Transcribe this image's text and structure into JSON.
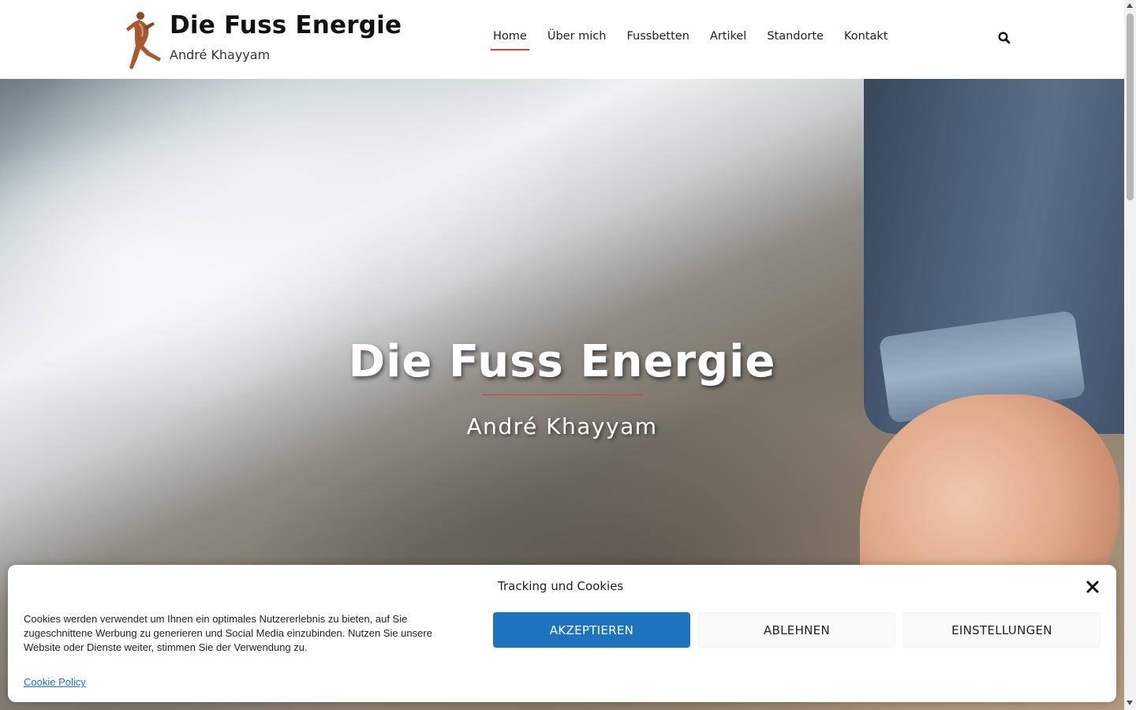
{
  "header": {
    "site_title": "Die Fuss Energie",
    "site_tagline": "André Khayyam",
    "nav": [
      {
        "label": "Home",
        "active": true
      },
      {
        "label": "Über mich",
        "active": false
      },
      {
        "label": "Fussbetten",
        "active": false
      },
      {
        "label": "Artikel",
        "active": false
      },
      {
        "label": "Standorte",
        "active": false
      },
      {
        "label": "Kontakt",
        "active": false
      }
    ],
    "search_icon": "search-icon",
    "logo_icon": "running-figure-logo"
  },
  "hero": {
    "title": "Die Fuss Energie",
    "subtitle": "André Khayyam"
  },
  "cookie_banner": {
    "title": "Tracking und Cookies",
    "text": "Cookies werden verwendet um Ihnen ein optimales Nutzererlebnis zu bieten, auf Sie zugeschnittene Werbung zu generieren und Social Media einzubinden. Nutzen Sie unsere Website oder Dienste weiter, stimmen Sie der Verwendung zu.",
    "policy_link": "Cookie Policy",
    "buttons": {
      "accept": "AKZEPTIEREN",
      "deny": "ABLEHNEN",
      "settings": "EINSTELLUNGEN"
    },
    "close_icon": "close-icon"
  },
  "colors": {
    "accent": "#c8443b",
    "primary_button": "#1e73be",
    "link": "#1e73be"
  }
}
